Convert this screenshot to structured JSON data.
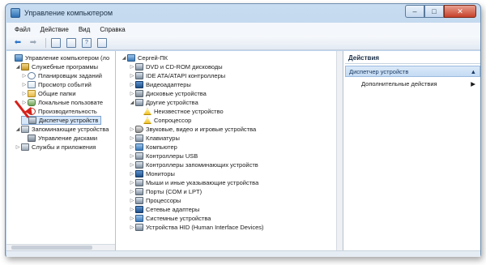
{
  "window": {
    "title": "Управление компьютером"
  },
  "caption": {
    "minimize": "–",
    "maximize": "□",
    "close": "✕"
  },
  "menu": [
    "Файл",
    "Действие",
    "Вид",
    "Справка"
  ],
  "toolbar": {
    "back_glyph": "⬅",
    "forward_glyph": "➡"
  },
  "left_tree": [
    {
      "label": "Управление компьютером (ло",
      "expander": "",
      "icon": "computer",
      "level": 0
    },
    {
      "label": "Служебные программы",
      "expander": "◢",
      "icon": "tools",
      "level": 1
    },
    {
      "label": "Планировщик заданий",
      "expander": "▷",
      "icon": "clock",
      "level": 2
    },
    {
      "label": "Просмотр событий",
      "expander": "▷",
      "icon": "log",
      "level": 2
    },
    {
      "label": "Общие папки",
      "expander": "▷",
      "icon": "folder",
      "level": 2
    },
    {
      "label": "Локальные пользовате",
      "expander": "▷",
      "icon": "users",
      "level": 2
    },
    {
      "label": "Производительность",
      "expander": "▷",
      "icon": "perf",
      "level": 2
    },
    {
      "label": "Диспетчер устройств",
      "expander": "",
      "icon": "device",
      "level": 2,
      "selected": true
    },
    {
      "label": "Запоминающие устройства",
      "expander": "◢",
      "icon": "storage",
      "level": 1
    },
    {
      "label": "Управление дисками",
      "expander": "",
      "icon": "disk",
      "level": 2
    },
    {
      "label": "Службы и приложения",
      "expander": "▷",
      "icon": "services",
      "level": 1
    }
  ],
  "device_tree": [
    {
      "label": "Сергей-ПК",
      "expander": "◢",
      "icon": "computer",
      "level": 0
    },
    {
      "label": "DVD и CD-ROM дисководы",
      "expander": "▷",
      "icon": "hw",
      "level": 1
    },
    {
      "label": "IDE ATA/ATAPI контроллеры",
      "expander": "▷",
      "icon": "hw",
      "level": 1
    },
    {
      "label": "Видеоадаптеры",
      "expander": "▷",
      "icon": "monitor",
      "level": 1
    },
    {
      "label": "Дисковые устройства",
      "expander": "▷",
      "icon": "disk",
      "level": 1
    },
    {
      "label": "Другие устройства",
      "expander": "◢",
      "icon": "hw",
      "level": 1
    },
    {
      "label": "Неизвестное устройство",
      "expander": "",
      "icon": "warn",
      "level": 2
    },
    {
      "label": "Сопроцессор",
      "expander": "",
      "icon": "warn",
      "level": 2
    },
    {
      "label": "Звуковые, видео и игровые устройства",
      "expander": "▷",
      "icon": "sound",
      "level": 1
    },
    {
      "label": "Клавиатуры",
      "expander": "▷",
      "icon": "hw",
      "level": 1
    },
    {
      "label": "Компьютер",
      "expander": "▷",
      "icon": "computer",
      "level": 1
    },
    {
      "label": "Контроллеры USB",
      "expander": "▷",
      "icon": "hw",
      "level": 1
    },
    {
      "label": "Контроллеры запоминающих устройств",
      "expander": "▷",
      "icon": "hw",
      "level": 1
    },
    {
      "label": "Мониторы",
      "expander": "▷",
      "icon": "monitor",
      "level": 1
    },
    {
      "label": "Мыши и иные указывающие устройства",
      "expander": "▷",
      "icon": "hw",
      "level": 1
    },
    {
      "label": "Порты (COM и LPT)",
      "expander": "▷",
      "icon": "hw",
      "level": 1
    },
    {
      "label": "Процессоры",
      "expander": "▷",
      "icon": "hw",
      "level": 1
    },
    {
      "label": "Сетевые адаптеры",
      "expander": "▷",
      "icon": "monitor",
      "level": 1
    },
    {
      "label": "Системные устройства",
      "expander": "▷",
      "icon": "computer",
      "level": 1
    },
    {
      "label": "Устройства HID (Human Interface Devices)",
      "expander": "▷",
      "icon": "hw",
      "level": 1
    }
  ],
  "actions": {
    "header": "Действия",
    "group_label": "Диспетчер устройств",
    "group_chevron": "▲",
    "item_label": "Дополнительные действия",
    "item_chevron": "▶"
  },
  "colors": {
    "selection": "#d6e7fa",
    "annotation_arrow": "#d8201a"
  }
}
